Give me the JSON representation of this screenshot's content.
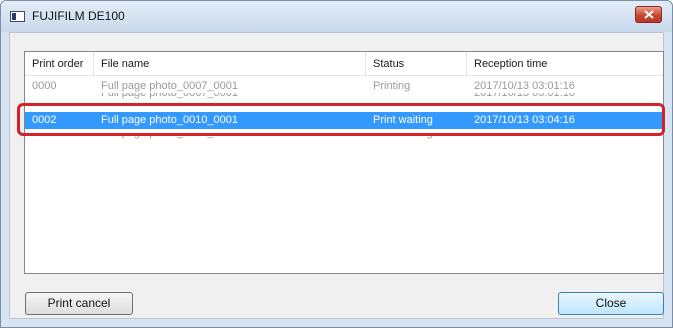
{
  "window": {
    "title": "FUJIFILM DE100",
    "icon": "app-window-icon",
    "close_icon": "close-icon"
  },
  "table": {
    "columns": [
      "Print order",
      "File name",
      "Status",
      "Reception time"
    ],
    "rows": [
      {
        "order": "0000",
        "file": "Full page photo_0007_0001",
        "status": "Printing",
        "time": "2017/10/13 03:01:16",
        "state": "dim"
      },
      {
        "order": "0002",
        "file": "Full page photo_0010_0001",
        "status": "Print waiting",
        "time": "2017/10/13 03:04:16",
        "state": "selected"
      }
    ]
  },
  "buttons": {
    "print_cancel": "Print cancel",
    "close": "Close"
  },
  "colors": {
    "selection": "#3399ff",
    "highlight_outline": "#d2232a",
    "close_button": "#c8462f"
  }
}
